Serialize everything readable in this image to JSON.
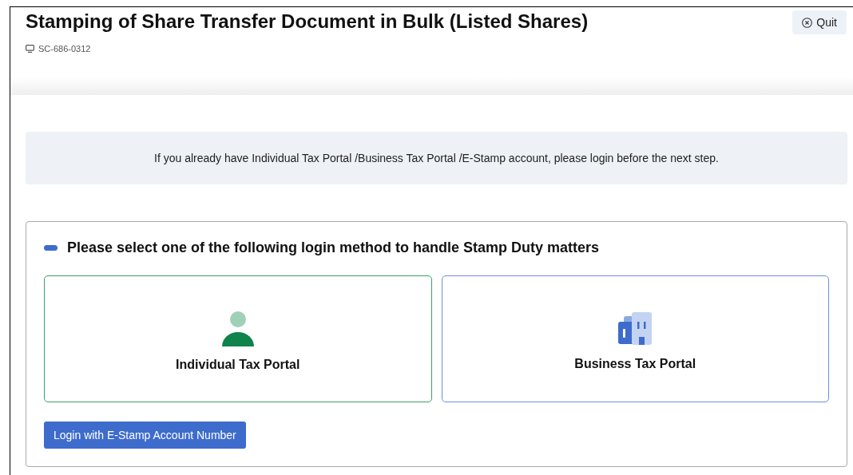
{
  "header": {
    "title": "Stamping of Share Transfer Document in Bulk (Listed Shares)",
    "code": "SC-686-0312",
    "quit_button": "Quit"
  },
  "notice": "If you already have Individual Tax Portal /Business Tax Portal /E-Stamp account, please login before the next step.",
  "login_section": {
    "heading": "Please select one of the following login method to handle Stamp Duty matters",
    "options": [
      {
        "kind": "individual",
        "label": "Individual Tax Portal"
      },
      {
        "kind": "business",
        "label": "Business Tax Portal"
      }
    ],
    "estamp_button": "Login with E-Stamp Account Number"
  }
}
